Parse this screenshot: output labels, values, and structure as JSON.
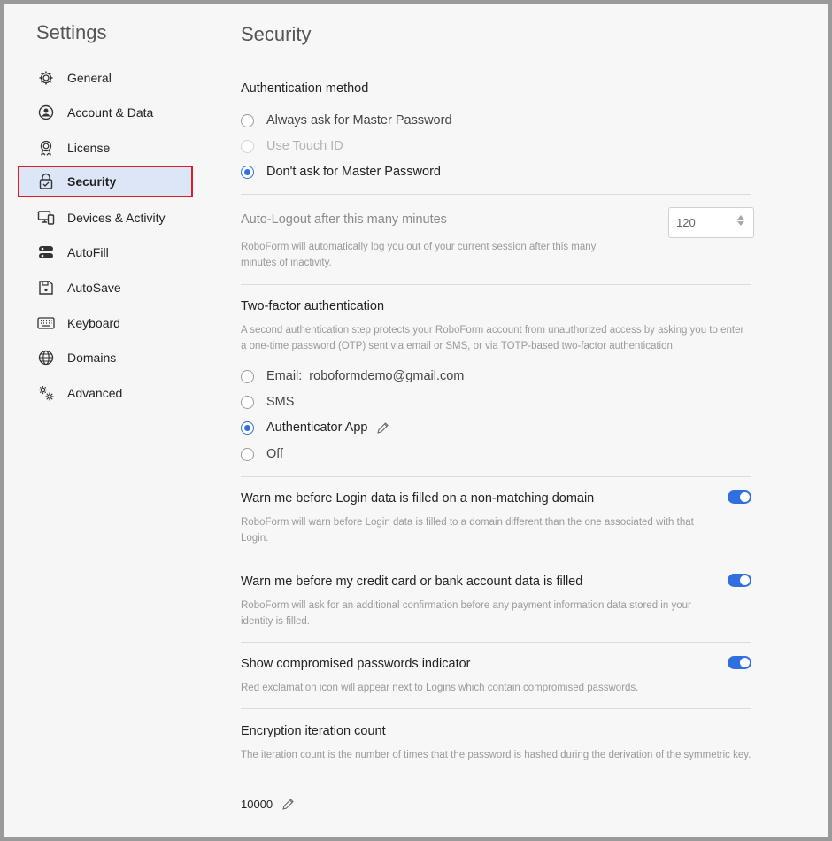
{
  "sidebar": {
    "title": "Settings",
    "items": [
      {
        "label": "General",
        "icon": "gear-icon"
      },
      {
        "label": "Account & Data",
        "icon": "user-circle-icon"
      },
      {
        "label": "License",
        "icon": "badge-icon"
      },
      {
        "label": "Security",
        "icon": "lock-icon",
        "active": true
      },
      {
        "label": "Devices & Activity",
        "icon": "devices-icon"
      },
      {
        "label": "AutoFill",
        "icon": "autofill-icon"
      },
      {
        "label": "AutoSave",
        "icon": "floppy-icon"
      },
      {
        "label": "Keyboard",
        "icon": "keyboard-icon"
      },
      {
        "label": "Domains",
        "icon": "globe-icon"
      },
      {
        "label": "Advanced",
        "icon": "gears-icon"
      }
    ]
  },
  "page": {
    "title": "Security"
  },
  "auth_method": {
    "heading": "Authentication method",
    "options": [
      {
        "label": "Always ask for Master Password",
        "state": "unchecked"
      },
      {
        "label": "Use Touch ID",
        "state": "disabled"
      },
      {
        "label": "Don't ask for Master Password",
        "state": "checked"
      }
    ]
  },
  "auto_logout": {
    "label": "Auto-Logout after this many minutes",
    "value": "120",
    "description": "RoboForm will automatically log you out of your current session after this many minutes of inactivity."
  },
  "two_factor": {
    "heading": "Two-factor authentication",
    "description": "A second authentication step protects your RoboForm account from unauthorized access by asking you to enter a one-time password (OTP) sent via email or SMS, or via TOTP-based two-factor authentication.",
    "options": [
      {
        "label": "Email:",
        "value": "roboformdemo@gmail.com",
        "state": "unchecked"
      },
      {
        "label": "SMS",
        "state": "unchecked"
      },
      {
        "label": "Authenticator App",
        "state": "checked"
      },
      {
        "label": "Off",
        "state": "unchecked"
      }
    ]
  },
  "toggles": [
    {
      "title": "Warn me before Login data is filled on a non-matching domain",
      "description": "RoboForm will warn before Login data is filled to a domain different than the one associated with that Login.",
      "on": true
    },
    {
      "title": "Warn me before my credit card or bank account data is filled",
      "description": "RoboForm will ask for an additional confirmation before any payment information data stored in your identity is filled.",
      "on": true
    },
    {
      "title": "Show compromised passwords indicator",
      "description": "Red exclamation icon will appear next to Logins which contain compromised passwords.",
      "on": true
    }
  ],
  "encryption": {
    "heading": "Encryption iteration count",
    "description": "The iteration count is the number of times that the password is hashed during the derivation of the symmetric key.",
    "value": "10000"
  },
  "colors": {
    "accent": "#2f6fe0",
    "highlight_border": "#e01b24",
    "active_bg": "#dce6f7"
  }
}
